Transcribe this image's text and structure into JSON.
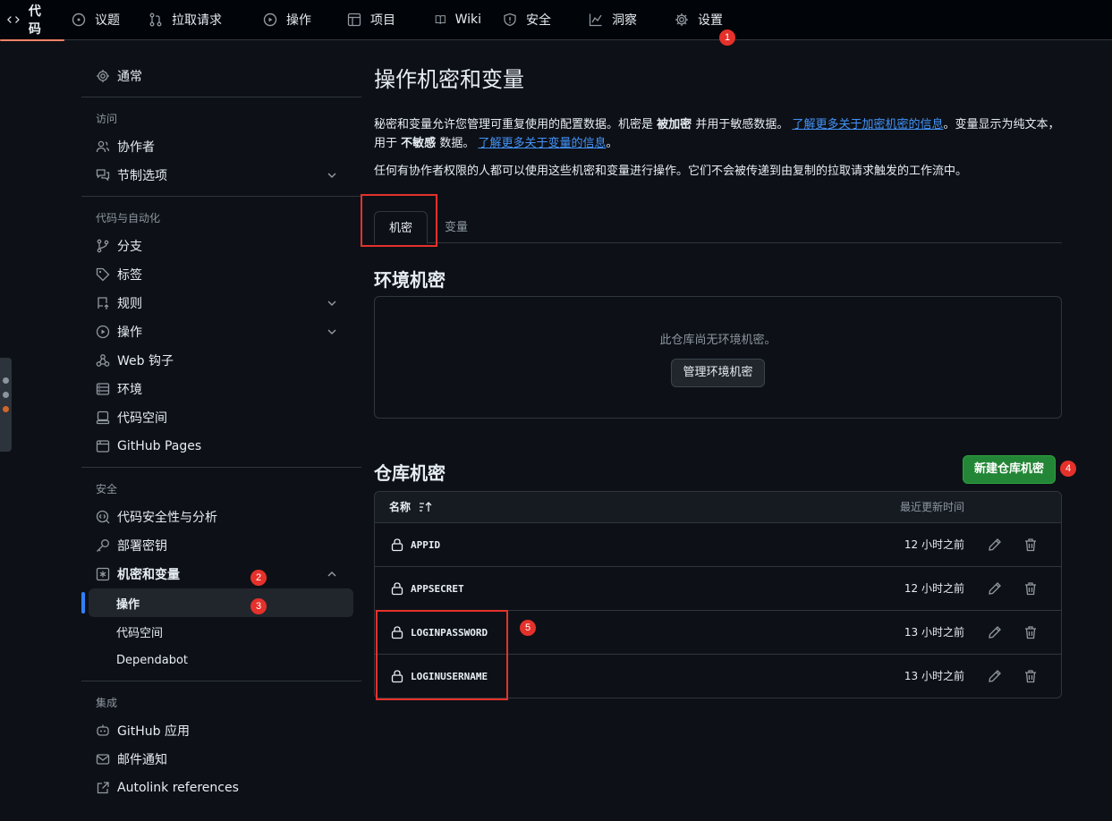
{
  "topnav": {
    "items": [
      {
        "label": "代码",
        "icon": "code-icon"
      },
      {
        "label": "议题",
        "icon": "issue-icon"
      },
      {
        "label": "拉取请求",
        "icon": "pull-request-icon"
      },
      {
        "label": "操作",
        "icon": "play-icon"
      },
      {
        "label": "项目",
        "icon": "table-icon"
      },
      {
        "label": "Wiki",
        "icon": "book-icon"
      },
      {
        "label": "安全",
        "icon": "shield-icon"
      },
      {
        "label": "洞察",
        "icon": "graph-icon"
      },
      {
        "label": "设置",
        "icon": "gear-icon"
      }
    ],
    "active": "代码"
  },
  "annotations": [
    "1",
    "2",
    "3",
    "4",
    "5"
  ],
  "sidebar": {
    "general": "通常",
    "access_head": "访问",
    "collaborators": "协作者",
    "moderation": "节制选项",
    "automation_head": "代码与自动化",
    "branches": "分支",
    "tags": "标签",
    "rules": "规则",
    "actions": "操作",
    "webhooks": "Web 钩子",
    "environments": "环境",
    "codespaces": "代码空间",
    "pages": "GitHub Pages",
    "security_head": "安全",
    "code_security": "代码安全性与分析",
    "deploy_keys": "部署密钥",
    "secrets_vars": "机密和变量",
    "sub_actions": "操作",
    "sub_codespaces": "代码空间",
    "sub_dependabot": "Dependabot",
    "integrations_head": "集成",
    "github_apps": "GitHub 应用",
    "email": "邮件通知",
    "autolink": "Autolink references"
  },
  "main": {
    "title": "操作机密和变量",
    "desc_part1": "秘密和变量允许您管理可重复使用的配置数据。机密是",
    "desc_bold1": "被加密",
    "desc_part2": "并用于敏感数据。",
    "desc_link1": "了解更多关于加密机密的信息",
    "desc_part3": "。变量显示为纯文本，用于",
    "desc_bold2": "不敏感",
    "desc_part4": "数据。",
    "desc_link2": "了解更多关于变量的信息",
    "desc_part5": "。",
    "desc2": "任何有协作者权限的人都可以使用这些机密和变量进行操作。它们不会被传递到由复制的拉取请求触发的工作流中。",
    "tab_secrets": "机密",
    "tab_variables": "变量",
    "env_title": "环境机密",
    "env_empty": "此仓库尚无环境机密。",
    "env_button": "管理环境机密",
    "repo_title": "仓库机密",
    "new_button": "新建仓库机密",
    "col_name": "名称",
    "col_updated": "最近更新时间",
    "secrets": [
      {
        "name": "APPID",
        "updated": "12 小时之前"
      },
      {
        "name": "APPSECRET",
        "updated": "12 小时之前"
      },
      {
        "name": "LOGINPASSWORD",
        "updated": "13 小时之前"
      },
      {
        "name": "LOGINUSERNAME",
        "updated": "13 小时之前"
      }
    ]
  },
  "colors": {
    "accent": "#f78166",
    "link": "#4493f8",
    "green": "#238636",
    "highlight": "#e5312b"
  }
}
